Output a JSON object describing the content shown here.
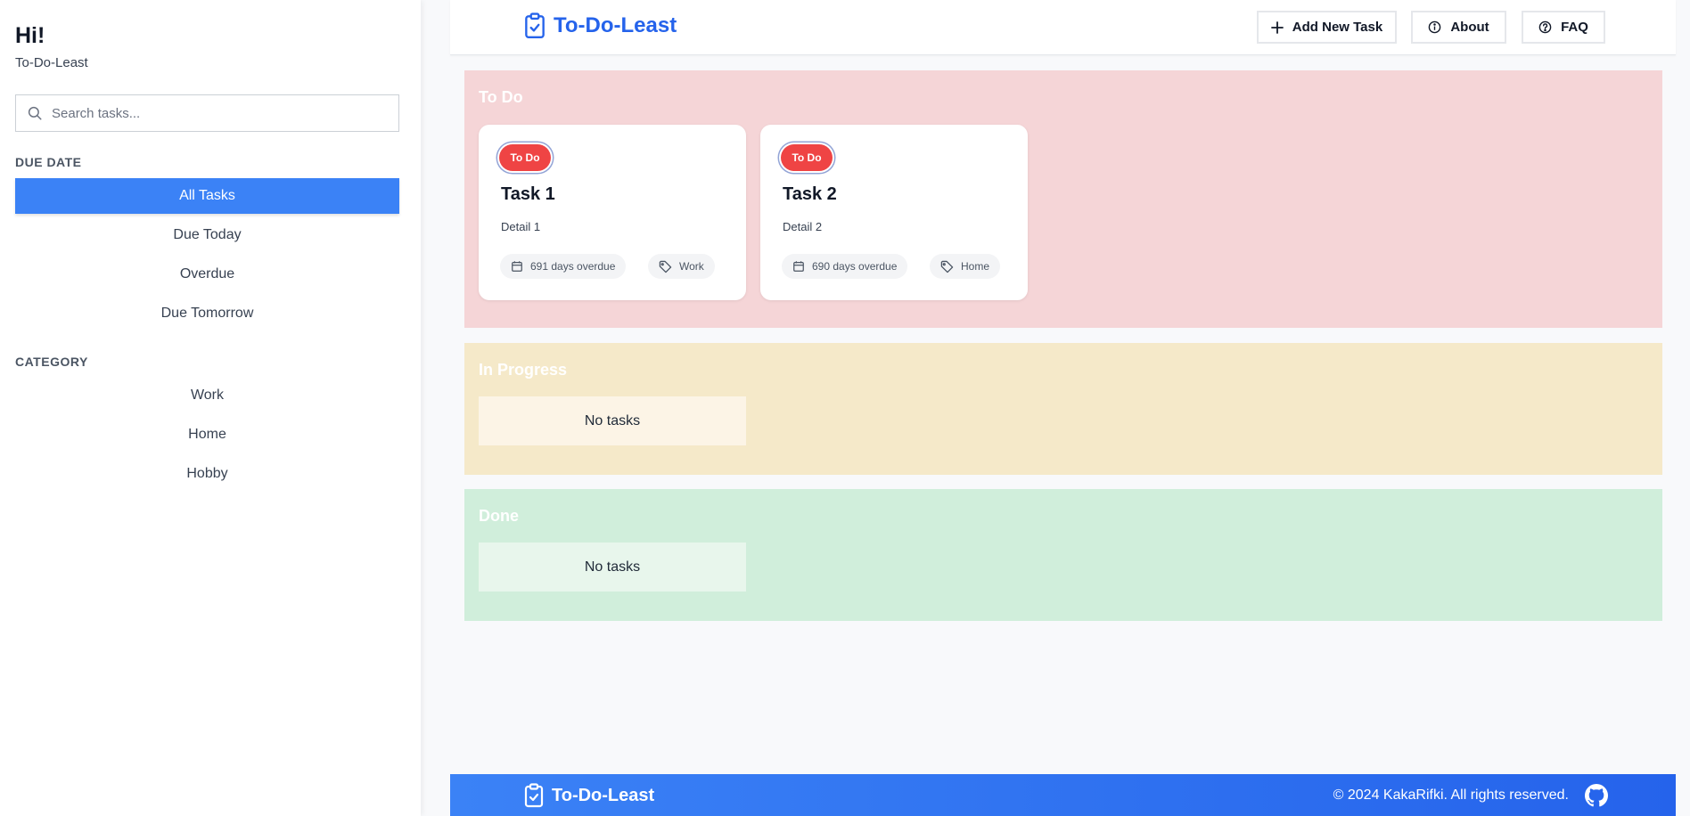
{
  "sidebar": {
    "greeting": "Hi!",
    "app_name": "To-Do-Least",
    "search_placeholder": "Search tasks...",
    "due_date_label": "DUE DATE",
    "due_date_items": [
      "All Tasks",
      "Due Today",
      "Overdue",
      "Due Tomorrow"
    ],
    "active_item": "All Tasks",
    "category_label": "CATEGORY",
    "category_items": [
      "Work",
      "Home",
      "Hobby"
    ]
  },
  "header": {
    "brand": "To-Do-Least",
    "add_task": "Add New Task",
    "about": "About",
    "faq": "FAQ"
  },
  "board": {
    "todo": {
      "title": "To Do",
      "tasks": [
        {
          "badge": "To Do",
          "title": "Task 1",
          "detail": "Detail 1",
          "due": "691 days overdue",
          "category": "Work"
        },
        {
          "badge": "To Do",
          "title": "Task 2",
          "detail": "Detail 2",
          "due": "690 days overdue",
          "category": "Home"
        }
      ]
    },
    "in_progress": {
      "title": "In Progress",
      "empty": "No tasks"
    },
    "done": {
      "title": "Done",
      "empty": "No tasks"
    }
  },
  "footer": {
    "brand": "To-Do-Least",
    "copyright": "© 2024 KakaRifki. All rights reserved."
  },
  "colors": {
    "accent": "#3b82f6",
    "brand_text": "#2563eb",
    "todo_bg": "#f5d5d7",
    "progress_bg": "#f5e9c9",
    "done_bg": "#d0eedb",
    "badge": "#ef4444"
  }
}
